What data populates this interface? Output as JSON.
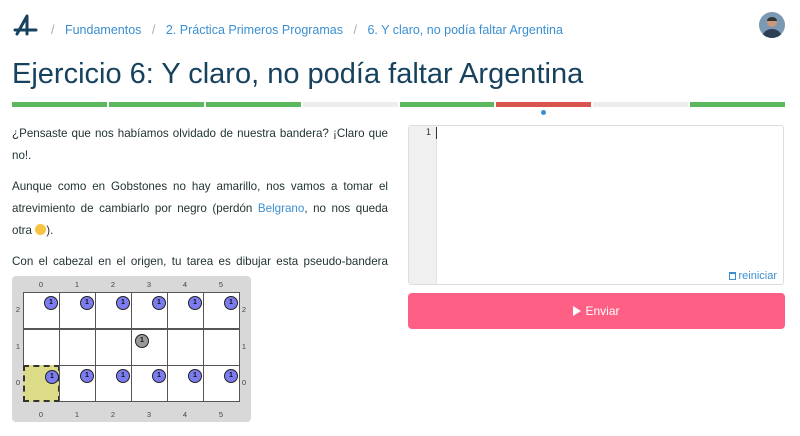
{
  "breadcrumbs": {
    "items": [
      "Fundamentos",
      "2. Práctica Primeros Programas",
      "6. Y claro, no podía faltar Argentina"
    ],
    "separator": "/"
  },
  "title": "Ejercicio 6: Y claro, no podía faltar Argentina",
  "progress": {
    "colors": {
      "solved": "#5cb85c",
      "failed": "#d9534f",
      "pending": "#eceeee"
    },
    "segments": [
      "solved",
      "solved",
      "solved",
      "pending",
      "solved",
      "failed",
      "pending",
      "solved"
    ],
    "current_index": 5
  },
  "description": {
    "p1": "¿Pensaste que nos habíamos olvidado de nuestra bandera? ¡Claro que no!.",
    "p2_before": "Aunque como en Gobstones no hay amarillo, nos vamos a tomar el atrevimiento de cambiarlo por negro (perdón ",
    "p2_link": "Belgrano",
    "p2_after": ", no nos queda otra ",
    "p2_end": ").",
    "p3": "Con el cabezal en el origen, tu tarea es dibujar esta pseudo-bandera argentina:"
  },
  "board": {
    "columns": [
      "0",
      "1",
      "2",
      "3",
      "4",
      "5"
    ],
    "rows": [
      "2",
      "1",
      "0"
    ],
    "ball_count": "1",
    "colors": {
      "blue": "#7c7cf0",
      "black": "#999999",
      "head": "#dcdc88"
    },
    "cells": [
      [
        {
          "color": "blue"
        },
        {
          "color": "blue"
        },
        {
          "color": "blue"
        },
        {
          "color": "blue"
        },
        {
          "color": "blue"
        },
        {
          "color": "blue"
        }
      ],
      [
        null,
        null,
        null,
        {
          "color": "black"
        },
        null,
        null
      ],
      [
        {
          "color": "blue",
          "head": true
        },
        {
          "color": "blue"
        },
        {
          "color": "blue"
        },
        {
          "color": "blue"
        },
        {
          "color": "blue"
        },
        {
          "color": "blue"
        }
      ]
    ]
  },
  "editor": {
    "line_number": "1",
    "reset_label": "reiniciar",
    "reset_icon": "trash-icon"
  },
  "submit": {
    "label": "Enviar",
    "icon": "play-icon",
    "color": "#fd5f85"
  }
}
